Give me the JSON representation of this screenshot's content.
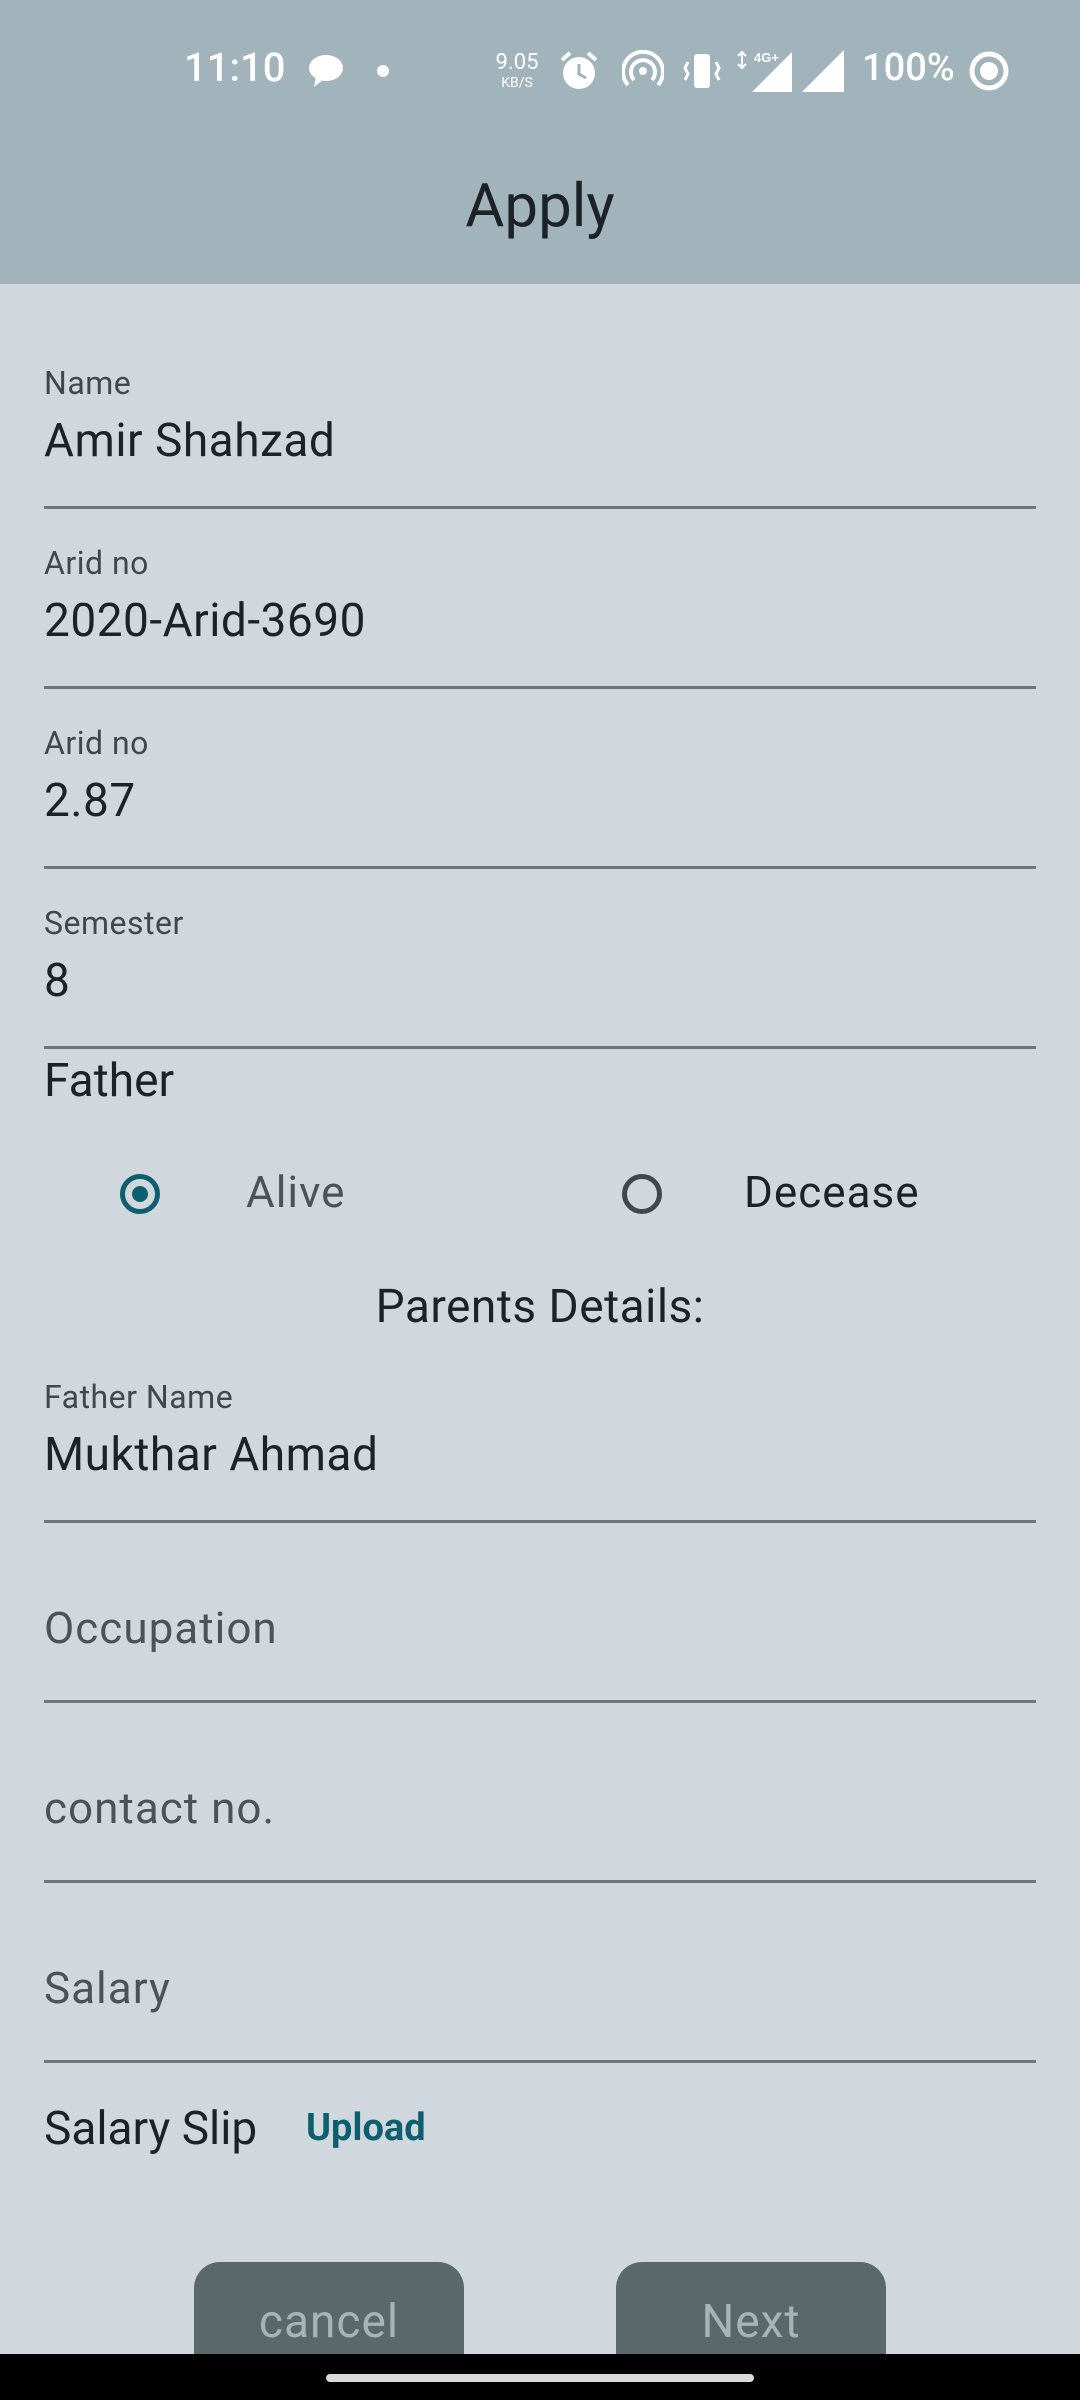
{
  "status_bar": {
    "time": "11:10",
    "net_speed_value": "9.05",
    "net_speed_unit": "KB/S",
    "battery": "100%",
    "icons": [
      "chat-bubble-icon",
      "dot-icon",
      "alarm-icon",
      "hotspot-icon",
      "vibrate-icon",
      "signal-4g-icon",
      "signal-icon",
      "battery-ring-icon"
    ]
  },
  "app_bar": {
    "title": "Apply"
  },
  "form": {
    "name": {
      "label": "Name",
      "value": "Amir Shahzad"
    },
    "arid_no": {
      "label": "Arid no",
      "value": "2020-Arid-3690"
    },
    "cgpa": {
      "label": "Arid no",
      "value": "2.87"
    },
    "semester": {
      "label": "Semester",
      "value": "8"
    },
    "father_status": {
      "label": "Father",
      "options": [
        {
          "label": "Alive",
          "selected": true
        },
        {
          "label": "Decease",
          "selected": false
        }
      ]
    },
    "parents_heading": "Parents Details:",
    "father_name": {
      "label": "Father Name",
      "value": "Mukthar Ahmad"
    },
    "occupation": {
      "placeholder": "Occupation"
    },
    "contact": {
      "placeholder": "contact no."
    },
    "salary": {
      "placeholder": "Salary"
    },
    "salary_slip": {
      "label": "Salary Slip",
      "upload_label": "Upload"
    }
  },
  "buttons": {
    "cancel": "cancel",
    "next": "Next"
  },
  "colors": {
    "accent": "#0d5e6e",
    "app_bar": "#a2b4bb",
    "background": "#d0d8de",
    "button": "#59696a"
  }
}
